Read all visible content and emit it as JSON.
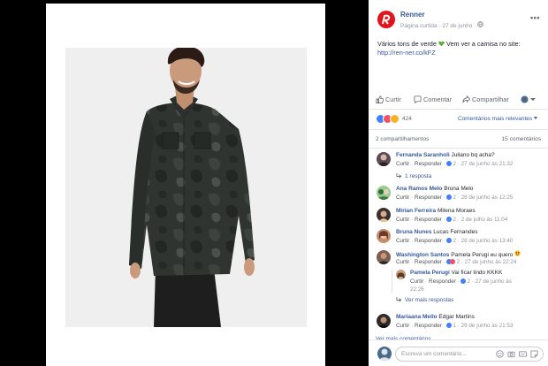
{
  "post": {
    "page_name": "Renner",
    "meta_text": "Página curtida · 27 de junho ·",
    "text_line1": "Vários tons de verde",
    "text_line1b": "Vem ver a camisa no site:",
    "link": "http://ren-ner.co/kFZ"
  },
  "actions": {
    "like": "Curtir",
    "comment": "Comentar",
    "share": "Compartilhar"
  },
  "reactions": {
    "count": "424",
    "sort_label": "Comentários mais relevantes"
  },
  "stats": {
    "shares": "2 compartilhamentos",
    "comments": "15 comentários"
  },
  "comments": [
    {
      "name": "Fernanda Saranholi",
      "text": "Juliano bq acha?",
      "meta_like": "Curtir",
      "meta_reply": "Responder",
      "likes": "2",
      "time": "27 de junho às 21:32"
    },
    {
      "name": "Ana Ramos Melo",
      "text": "Bruna Melo",
      "meta_like": "Curtir",
      "meta_reply": "Responder",
      "likes": "2",
      "time": "28 de junho às 12:25"
    },
    {
      "name": "Mirian Ferreira",
      "text": "Milena Moraes",
      "meta_like": "Curtir",
      "meta_reply": "Responder",
      "likes": "2",
      "time": "2 de julho às 11:04"
    },
    {
      "name": "Bruna Nunes",
      "text": "Lucas Fernandes",
      "meta_like": "Curtir",
      "meta_reply": "Responder",
      "likes": "2",
      "time": "28 de junho às 13:40"
    },
    {
      "name": "Washington Santos",
      "text": "Pamela Perugi eu quero",
      "meta_like": "Curtir",
      "meta_reply": "Responder",
      "likes": "2",
      "time": "27 de junho às 22:24"
    },
    {
      "name": "Mariaana Mello",
      "text": "Edgar Martins",
      "meta_like": "Curtir",
      "meta_reply": "Responder",
      "likes": "1",
      "time": "29 de junho às 21:53"
    }
  ],
  "replies_link_1": "1 resposta",
  "nested_reply": {
    "name": "Pamela Perugi",
    "text": "Vai ficar lindo KKKK",
    "meta_like": "Curtir",
    "meta_reply": "Responder",
    "likes": "2",
    "time_a": "27 de junho às",
    "time_b": "22:26"
  },
  "more_replies": "Ver mais respostas",
  "more_comments": "Ver mais comentários",
  "composer": {
    "placeholder": "Escreva um comentário..."
  },
  "colors": {
    "brand": "#e2141b",
    "link": "#365899",
    "like_blue": "#4080ff"
  }
}
